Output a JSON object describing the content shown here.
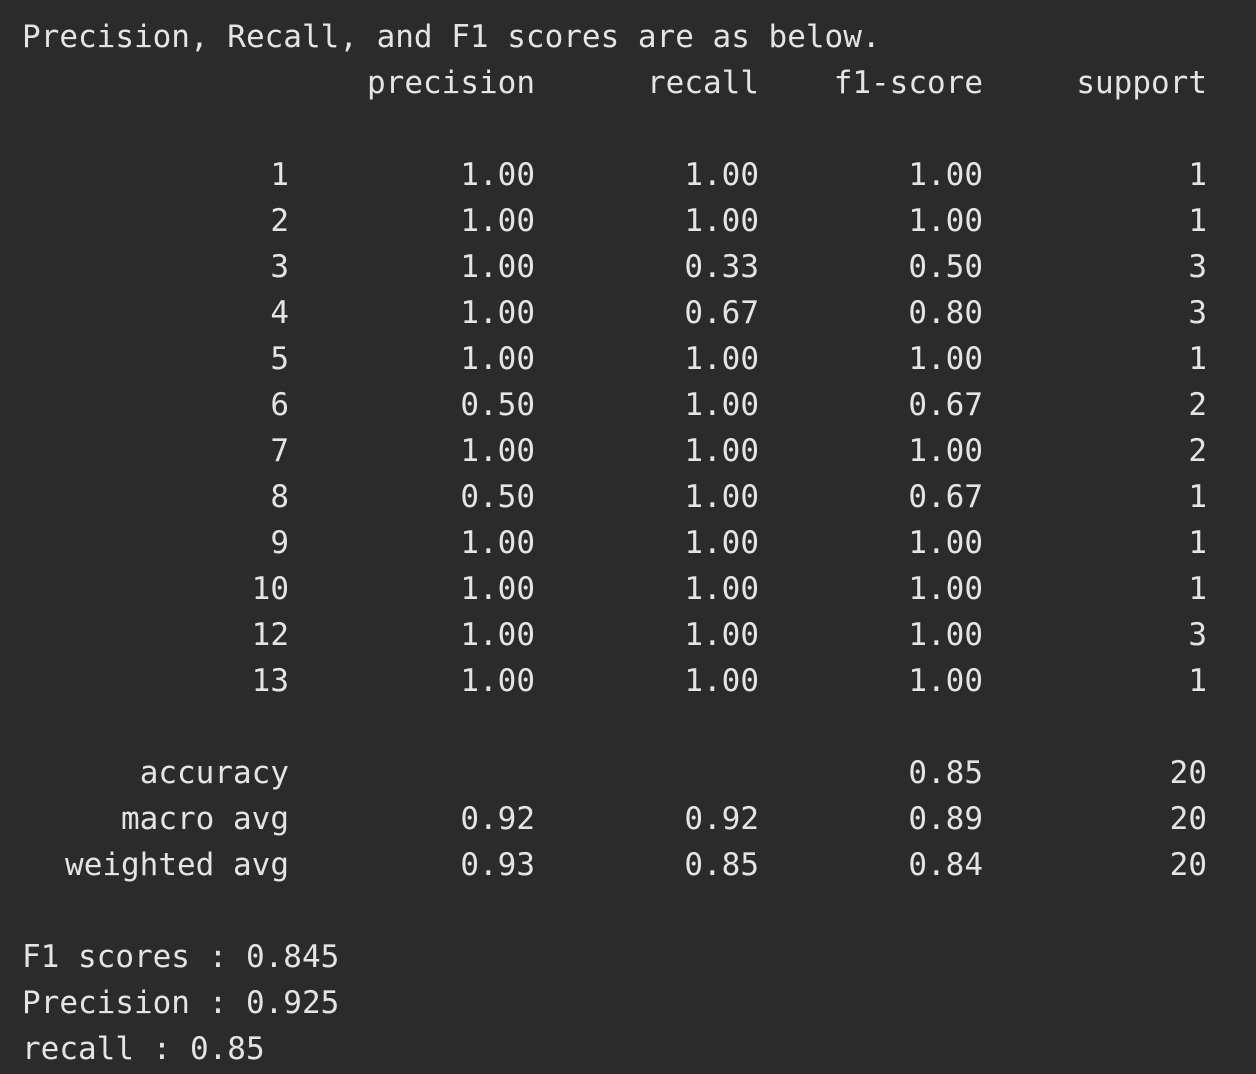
{
  "intro": "Precision, Recall, and F1 scores are as below.",
  "headers": {
    "precision": "precision",
    "recall": "recall",
    "f1": "f1-score",
    "support": "support"
  },
  "rows": [
    {
      "label": "1",
      "precision": "1.00",
      "recall": "1.00",
      "f1": "1.00",
      "support": "1"
    },
    {
      "label": "2",
      "precision": "1.00",
      "recall": "1.00",
      "f1": "1.00",
      "support": "1"
    },
    {
      "label": "3",
      "precision": "1.00",
      "recall": "0.33",
      "f1": "0.50",
      "support": "3"
    },
    {
      "label": "4",
      "precision": "1.00",
      "recall": "0.67",
      "f1": "0.80",
      "support": "3"
    },
    {
      "label": "5",
      "precision": "1.00",
      "recall": "1.00",
      "f1": "1.00",
      "support": "1"
    },
    {
      "label": "6",
      "precision": "0.50",
      "recall": "1.00",
      "f1": "0.67",
      "support": "2"
    },
    {
      "label": "7",
      "precision": "1.00",
      "recall": "1.00",
      "f1": "1.00",
      "support": "2"
    },
    {
      "label": "8",
      "precision": "0.50",
      "recall": "1.00",
      "f1": "0.67",
      "support": "1"
    },
    {
      "label": "9",
      "precision": "1.00",
      "recall": "1.00",
      "f1": "1.00",
      "support": "1"
    },
    {
      "label": "10",
      "precision": "1.00",
      "recall": "1.00",
      "f1": "1.00",
      "support": "1"
    },
    {
      "label": "12",
      "precision": "1.00",
      "recall": "1.00",
      "f1": "1.00",
      "support": "3"
    },
    {
      "label": "13",
      "precision": "1.00",
      "recall": "1.00",
      "f1": "1.00",
      "support": "1"
    }
  ],
  "summary": [
    {
      "label": "accuracy",
      "precision": "",
      "recall": "",
      "f1": "0.85",
      "support": "20"
    },
    {
      "label": "macro avg",
      "precision": "0.92",
      "recall": "0.92",
      "f1": "0.89",
      "support": "20"
    },
    {
      "label": "weighted avg",
      "precision": "0.93",
      "recall": "0.85",
      "f1": "0.84",
      "support": "20"
    }
  ],
  "footer": {
    "f1_line": "F1 scores : 0.845",
    "precision_line": "Precision : 0.925",
    "recall_line": "recall : 0.85"
  },
  "colors": {
    "background": "#2b2b2b",
    "text": "#e4e4e4"
  }
}
